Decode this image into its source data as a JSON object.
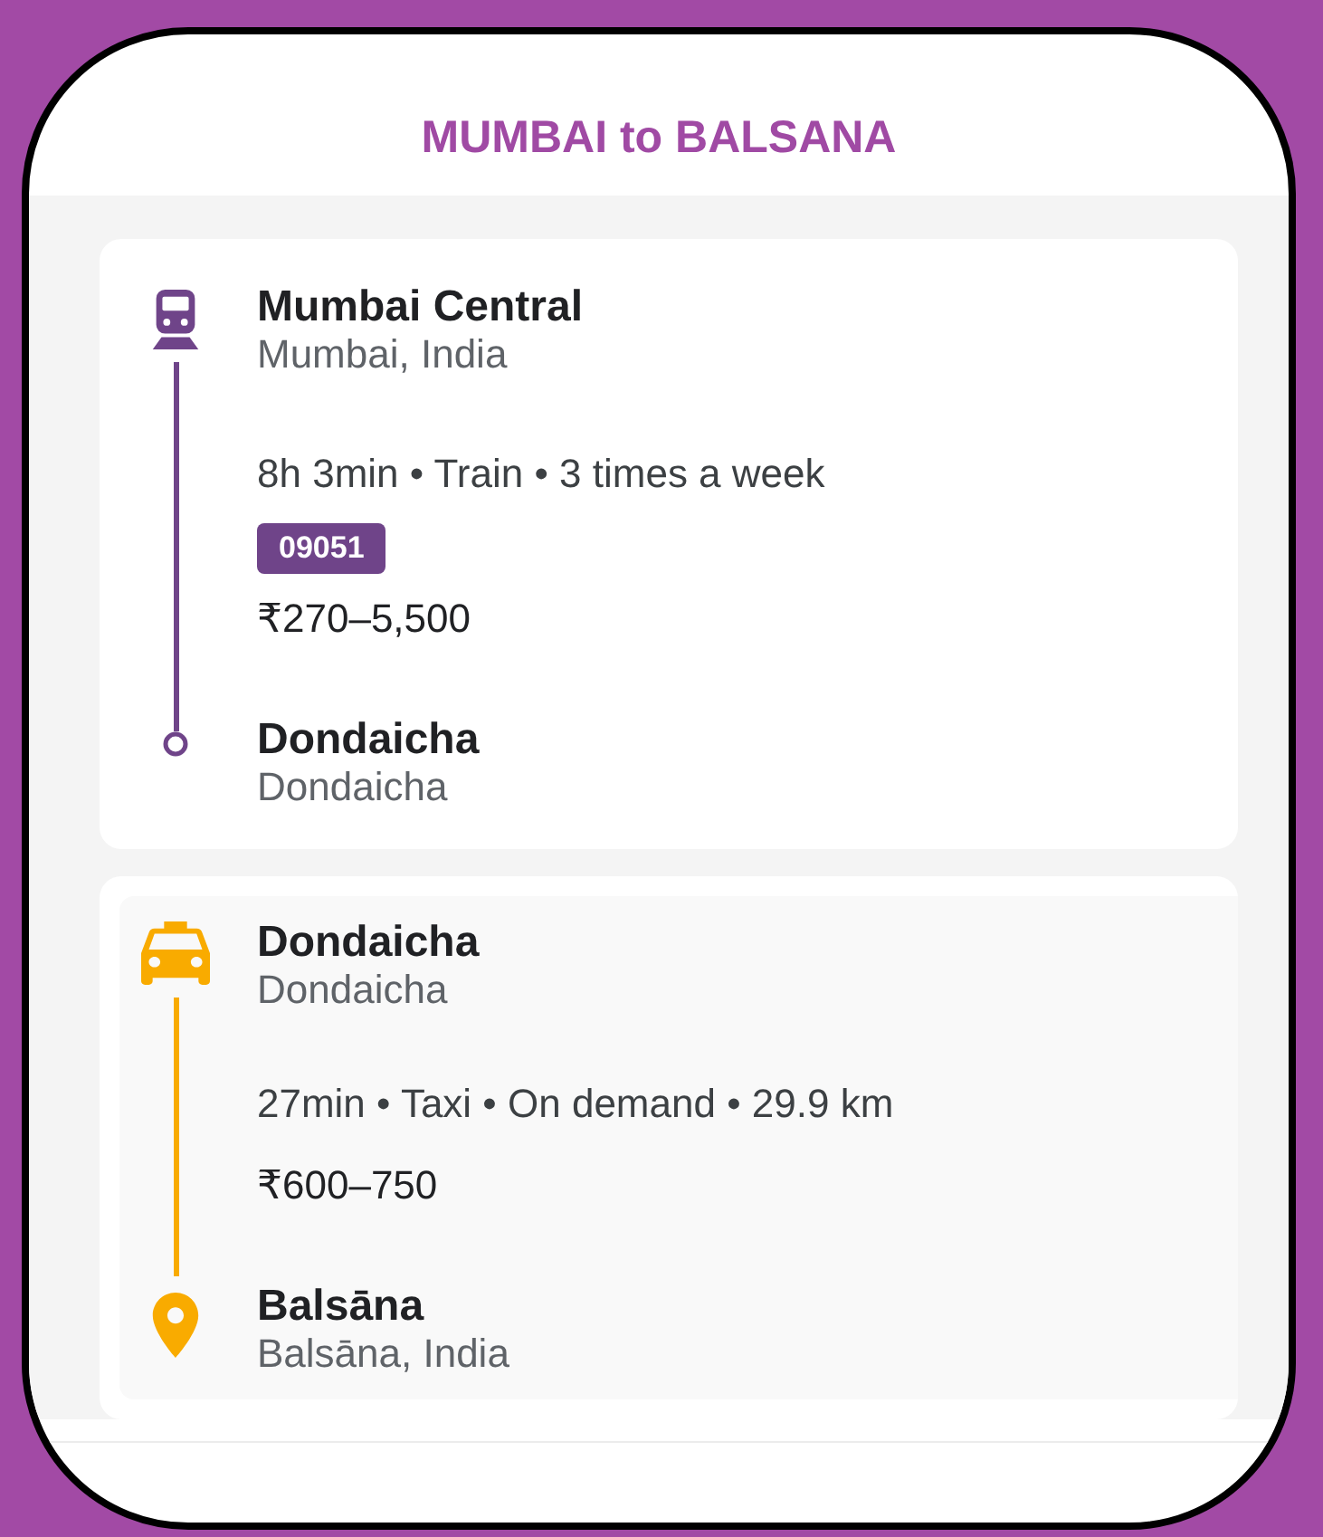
{
  "title": "MUMBAI to BALSANA",
  "segments": [
    {
      "kind": "train",
      "color": "#6f4489",
      "highlighted": false,
      "origin": {
        "name": "Mumbai Central",
        "place": "Mumbai, India"
      },
      "summary": "8h 3min • Train • 3 times a week",
      "badge": "09051",
      "price": "₹270–5,500",
      "destination": {
        "kind": "stop",
        "name": "Dondaicha",
        "place": "Dondaicha"
      }
    },
    {
      "kind": "taxi",
      "color": "#f9ab00",
      "highlighted": true,
      "origin": {
        "name": "Dondaicha",
        "place": "Dondaicha"
      },
      "summary": "27min • Taxi • On demand • 29.9 km",
      "price": "₹600–750",
      "destination": {
        "kind": "pin",
        "name": "Balsāna",
        "place": "Balsāna, India"
      }
    }
  ]
}
